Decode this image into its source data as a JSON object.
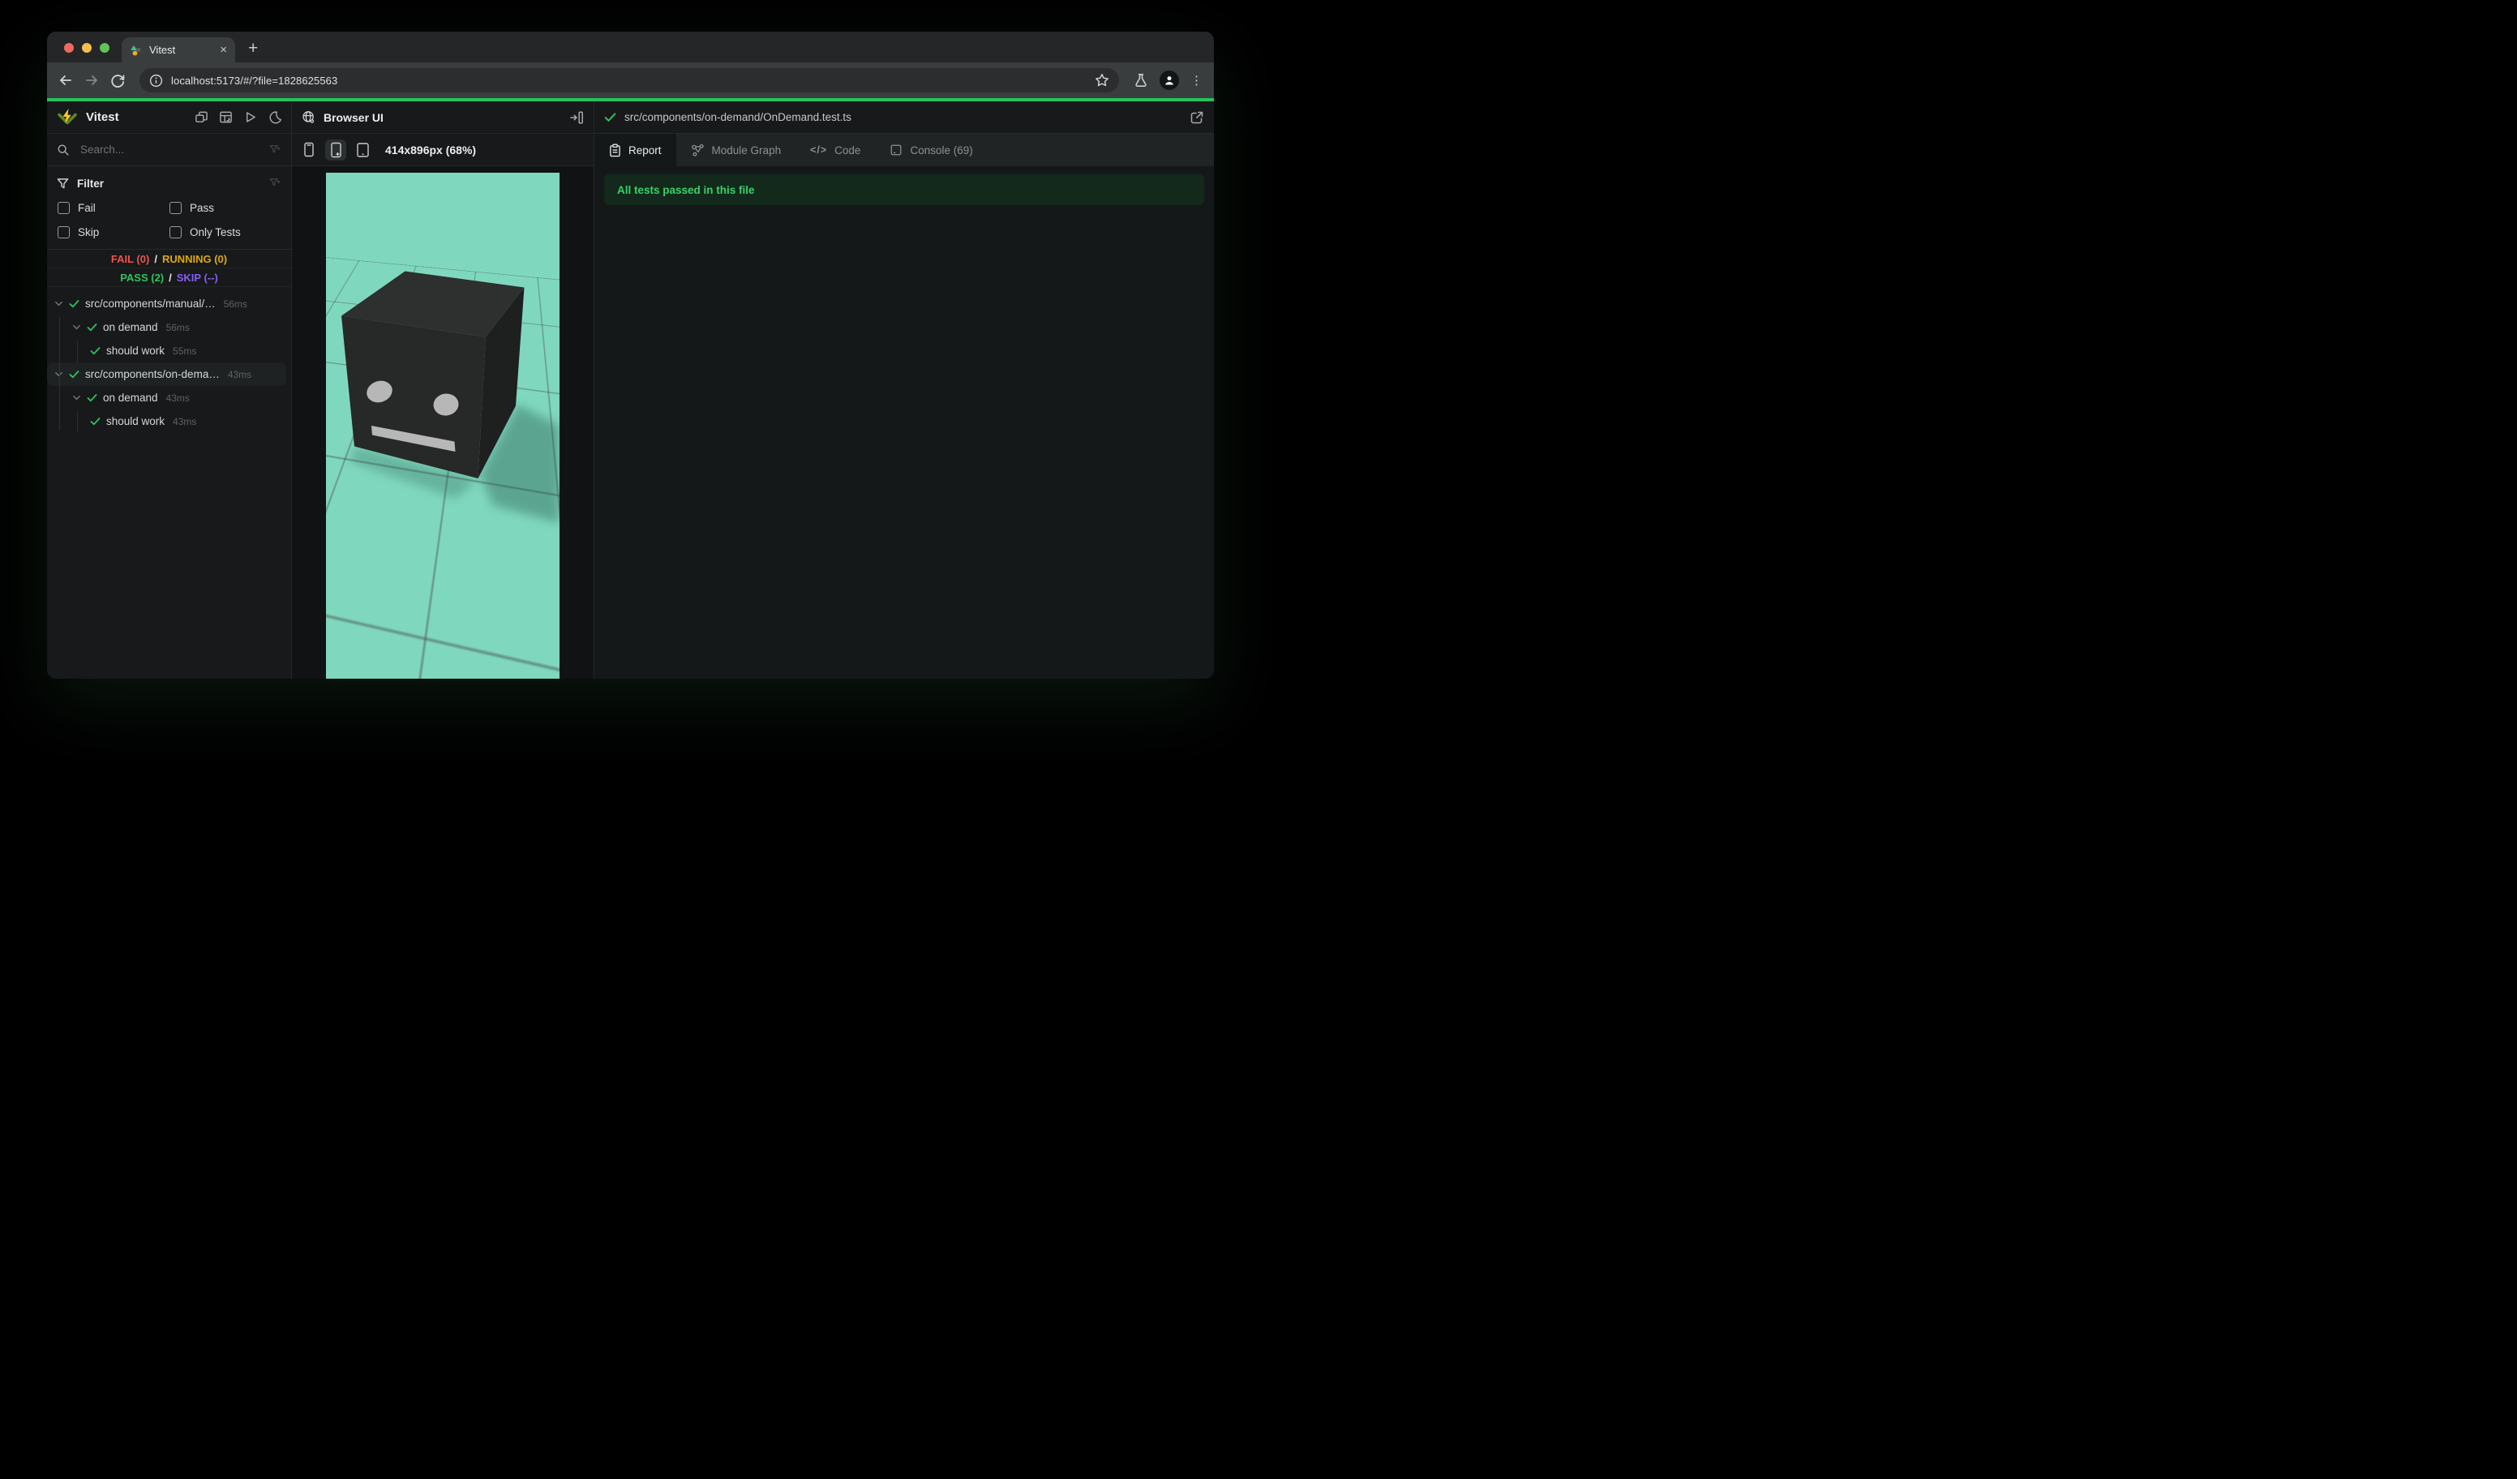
{
  "colors": {
    "accent_green": "#22c35c",
    "mint_bg": "#7fd8be",
    "fail": "#ef5350",
    "running": "#dfa90c",
    "pass": "#31c35c",
    "skip": "#8b5cf6",
    "banner_bg": "#12291b",
    "banner_text": "#3bd06c",
    "traffic_red": "#ed6a5e",
    "traffic_yellow": "#f5bf4f",
    "traffic_green": "#61c554"
  },
  "glyphs": {
    "close": "×",
    "new_tab": "+",
    "kebab": "⋮",
    "code": "</>"
  },
  "browser": {
    "tab_title": "Vitest",
    "url": "localhost:5173/#/?file=1828625563"
  },
  "sidebar": {
    "title": "Vitest",
    "search_placeholder": "Search...",
    "filter": {
      "title": "Filter",
      "options": [
        {
          "label": "Fail",
          "checked": false
        },
        {
          "label": "Pass",
          "checked": false
        },
        {
          "label": "Skip",
          "checked": false
        },
        {
          "label": "Only Tests",
          "checked": false
        }
      ]
    },
    "stats": {
      "fail": "FAIL (0)",
      "sep1": "/",
      "running": "RUNNING (0)",
      "pass": "PASS (2)",
      "sep2": "/",
      "skip": "SKIP (--)"
    },
    "tree": {
      "items": [
        {
          "label": "src/components/manual/…",
          "time": "56ms",
          "level": "file",
          "state": "pass",
          "selected": false
        },
        {
          "label": "on demand",
          "time": "56ms",
          "level": "suite",
          "state": "pass",
          "selected": false
        },
        {
          "label": "should work",
          "time": "55ms",
          "level": "test",
          "state": "pass",
          "selected": false
        },
        {
          "label": "src/components/on-dema…",
          "time": "43ms",
          "level": "file",
          "state": "pass",
          "selected": true
        },
        {
          "label": "on demand",
          "time": "43ms",
          "level": "suite",
          "state": "pass",
          "selected": false
        },
        {
          "label": "should work",
          "time": "43ms",
          "level": "test",
          "state": "pass",
          "selected": false
        }
      ]
    }
  },
  "preview_panel": {
    "title": "Browser UI",
    "viewport_label": "414x896px (68%)",
    "active_device_index": 1
  },
  "results_panel": {
    "file_path": "src/components/on-demand/OnDemand.test.ts",
    "tabs": [
      {
        "label": "Report",
        "active": true
      },
      {
        "label": "Module Graph",
        "active": false
      },
      {
        "label": "Code",
        "active": false
      },
      {
        "label": "Console (69)",
        "active": false
      }
    ],
    "banner": "All tests passed in this file"
  }
}
